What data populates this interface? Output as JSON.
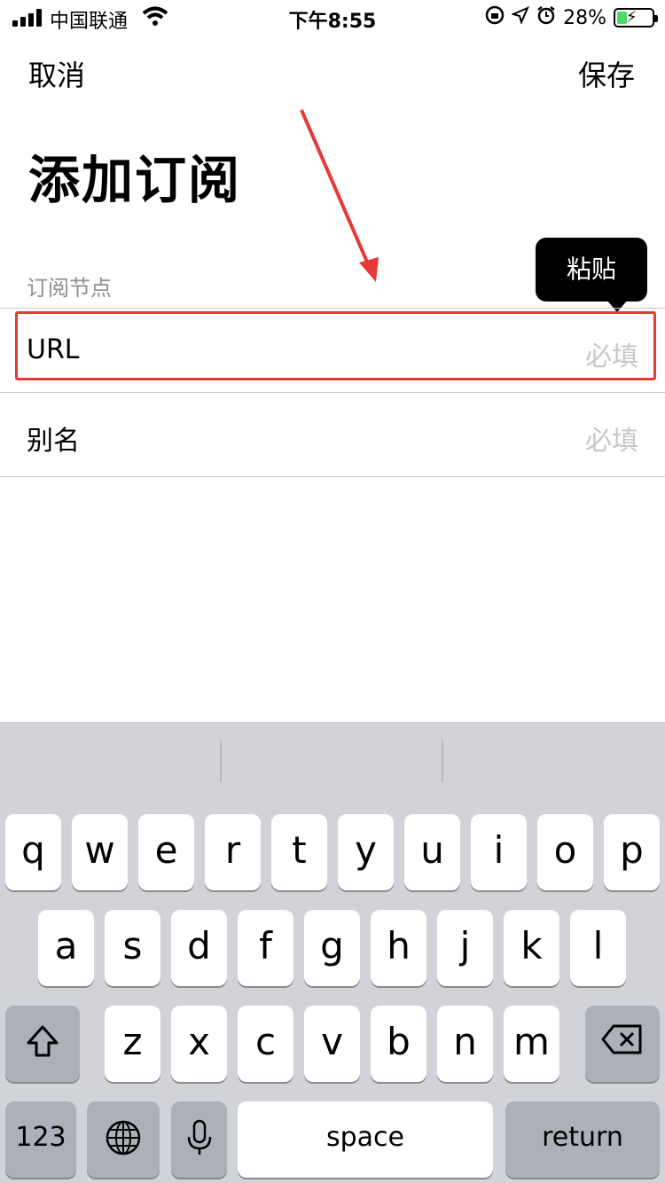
{
  "status_bar": {
    "carrier": "中国联通",
    "time": "下午8:55",
    "battery_percent": "28%",
    "battery_level": 0.28,
    "icons": [
      "signal-icon",
      "wifi-icon",
      "orientation-lock-icon",
      "location-icon",
      "alarm-icon",
      "battery-icon"
    ]
  },
  "nav": {
    "cancel_label": "取消",
    "save_label": "保存"
  },
  "page": {
    "title": "添加订阅"
  },
  "section": {
    "label": "订阅节点"
  },
  "form": {
    "url": {
      "label": "URL",
      "placeholder": "必填"
    },
    "alias": {
      "label": "别名",
      "placeholder": "必填"
    }
  },
  "tooltip": {
    "label": "粘贴"
  },
  "annotation": {
    "arrow_color": "#e53935",
    "box_color": "#e53935"
  },
  "keyboard": {
    "row1": [
      "q",
      "w",
      "e",
      "r",
      "t",
      "y",
      "u",
      "i",
      "o",
      "p"
    ],
    "row2": [
      "a",
      "s",
      "d",
      "f",
      "g",
      "h",
      "j",
      "k",
      "l"
    ],
    "row3": [
      "z",
      "x",
      "c",
      "v",
      "b",
      "n",
      "m"
    ],
    "numbers_label": "123",
    "space_label": "space",
    "return_label": "return",
    "icons": [
      "shift-icon",
      "backspace-icon",
      "globe-icon",
      "microphone-icon"
    ]
  }
}
